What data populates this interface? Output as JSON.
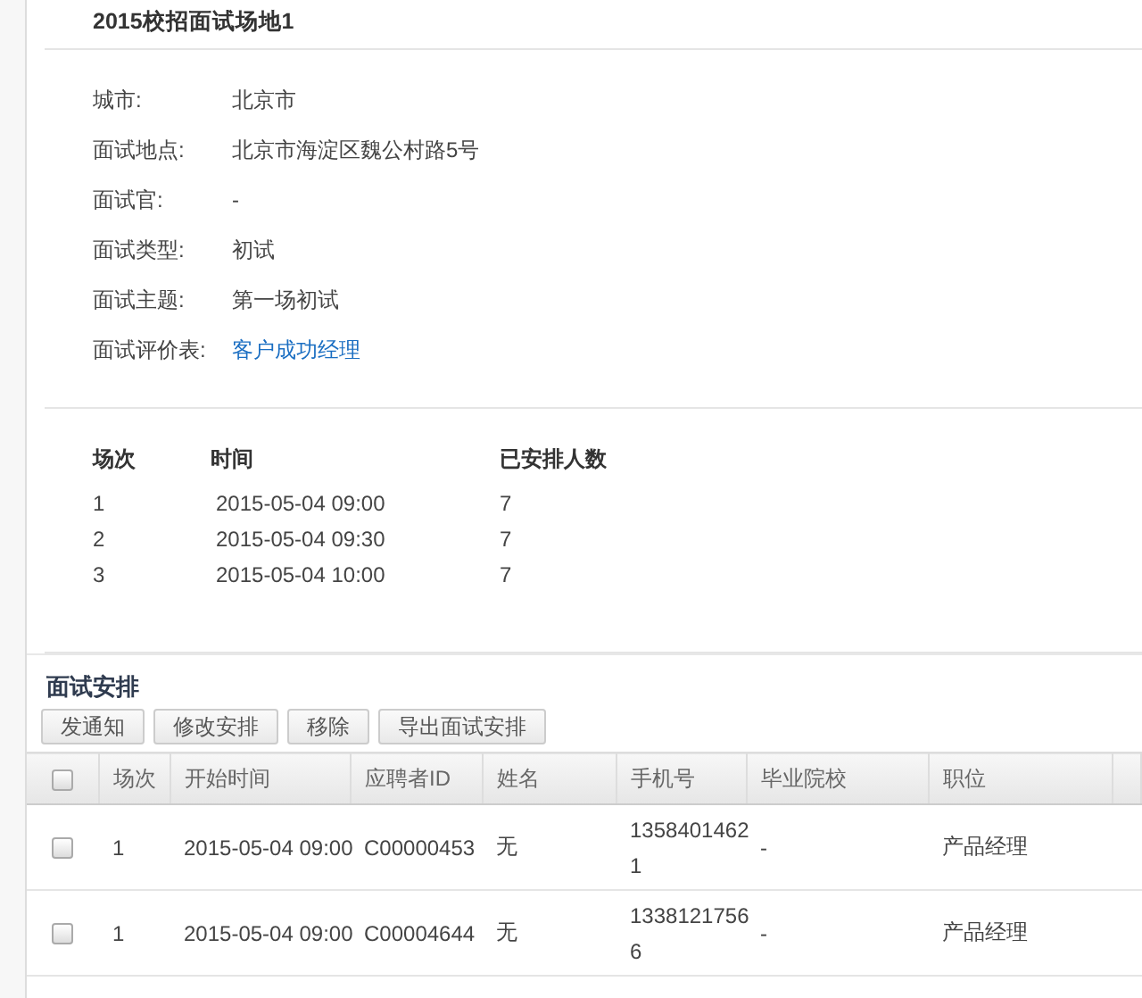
{
  "venue": {
    "title": "2015校招面试场地1",
    "fields": [
      {
        "label": "城市:",
        "value": "北京市",
        "kind": "text"
      },
      {
        "label": "面试地点:",
        "value": "北京市海淀区魏公村路5号",
        "kind": "text"
      },
      {
        "label": "面试官:",
        "value": "-",
        "kind": "text"
      },
      {
        "label": "面试类型:",
        "value": "初试",
        "kind": "text"
      },
      {
        "label": "面试主题:",
        "value": "第一场初试",
        "kind": "text"
      },
      {
        "label": "面试评价表:",
        "value": "客户成功经理",
        "kind": "link"
      }
    ]
  },
  "sessions": {
    "columns": [
      "场次",
      "时间",
      "已安排人数"
    ],
    "rows": [
      [
        "1",
        "2015-05-04 09:00",
        "7"
      ],
      [
        "2",
        "2015-05-04 09:30",
        "7"
      ],
      [
        "3",
        "2015-05-04 10:00",
        "7"
      ]
    ]
  },
  "arrangement": {
    "title": "面试安排",
    "buttons": [
      "发通知",
      "修改安排",
      "移除",
      "导出面试安排"
    ],
    "header_checked": false,
    "columns": [
      "场次",
      "开始时间",
      "应聘者ID",
      "姓名",
      "手机号",
      "毕业院校",
      "职位"
    ],
    "rows": [
      {
        "checked": false,
        "cells": [
          "1",
          "2015-05-04 09:00",
          "C00000453",
          "无",
          "13584014621",
          "-",
          "产品经理"
        ]
      },
      {
        "checked": false,
        "cells": [
          "1",
          "2015-05-04 09:00",
          "C00004644",
          "无",
          "13381217566",
          "-",
          "产品经理"
        ]
      }
    ]
  }
}
